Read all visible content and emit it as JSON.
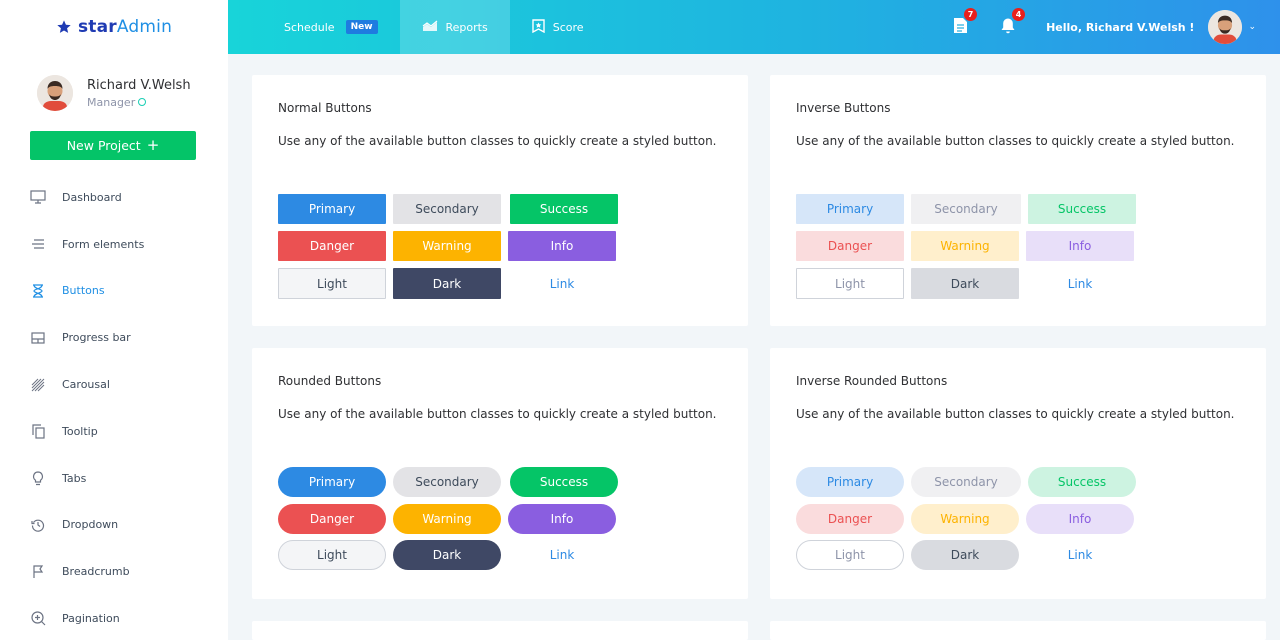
{
  "brand": {
    "name_bold": "star",
    "name_light": "Admin"
  },
  "profile": {
    "name": "Richard V.Welsh",
    "role": "Manager"
  },
  "sidebar": {
    "new_project_label": "New Project",
    "items": [
      {
        "label": "Dashboard",
        "icon": "monitor-icon"
      },
      {
        "label": "Form elements",
        "icon": "lines-icon"
      },
      {
        "label": "Buttons",
        "icon": "hourglass-icon",
        "active": true
      },
      {
        "label": "Progress bar",
        "icon": "layout-icon"
      },
      {
        "label": "Carousal",
        "icon": "hatch-icon"
      },
      {
        "label": "Tooltip",
        "icon": "copy-icon"
      },
      {
        "label": "Tabs",
        "icon": "bulb-icon"
      },
      {
        "label": "Dropdown",
        "icon": "history-icon"
      },
      {
        "label": "Breadcrumb",
        "icon": "flag-icon"
      },
      {
        "label": "Pagination",
        "icon": "zoom-in-icon"
      }
    ]
  },
  "topnav": {
    "schedule": "Schedule",
    "schedule_badge": "New",
    "reports": "Reports",
    "score": "Score",
    "messages_count": "7",
    "notifications_count": "4",
    "greeting": "Hello, Richard V.Welsh !"
  },
  "cards": [
    {
      "title": "Normal Buttons",
      "description": "Use any of the available button classes to quickly create a styled button.",
      "buttons": [
        "Primary",
        "Secondary",
        "Success",
        "Danger",
        "Warning",
        "Info",
        "Light",
        "Dark",
        "Link"
      ]
    },
    {
      "title": "Inverse Buttons",
      "description": "Use any of the available button classes to quickly create a styled button.",
      "buttons": [
        "Primary",
        "Secondary",
        "Success",
        "Danger",
        "Warning",
        "Info",
        "Light",
        "Dark",
        "Link"
      ]
    },
    {
      "title": "Rounded Buttons",
      "description": "Use any of the available button classes to quickly create a styled button.",
      "buttons": [
        "Primary",
        "Secondary",
        "Success",
        "Danger",
        "Warning",
        "Info",
        "Light",
        "Dark",
        "Link"
      ]
    },
    {
      "title": "Inverse Rounded Buttons",
      "description": "Use any of the available button classes to quickly create a styled button.",
      "buttons": [
        "Primary",
        "Secondary",
        "Success",
        "Danger",
        "Warning",
        "Info",
        "Light",
        "Dark",
        "Link"
      ]
    }
  ],
  "colors": {
    "primary": "#2d8ae3",
    "success": "#05c567",
    "danger": "#eb5152",
    "warning": "#fdb300",
    "info": "#8a5ee0",
    "dark": "#3f4865",
    "accent_green": "#04c468"
  }
}
